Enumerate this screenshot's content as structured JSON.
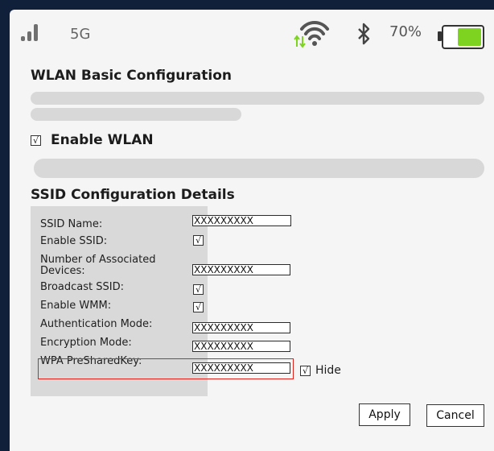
{
  "status_bar": {
    "network": "5G",
    "battery_percent": "70%",
    "battery_level": 0.7,
    "icons": [
      "signal-icon",
      "wifi-icon",
      "bluetooth-icon",
      "battery-icon"
    ]
  },
  "wlan_basic": {
    "title": "WLAN Basic Configuration",
    "enable_wlan_label": "Enable WLAN",
    "enable_wlan_checked": true
  },
  "ssid_config": {
    "title": "SSID Configuration Details",
    "ssid_name_label": "SSID Name:",
    "ssid_name_value": "XXXXXXXXX",
    "enable_ssid_label": "Enable SSID:",
    "associated_devices_label": "Number of Associated Devices:",
    "associated_devices_value": "XXXXXXXXX",
    "broadcast_ssid_label": "Broadcast SSID:",
    "enable_wmm_label": "Enable WMM:",
    "auth_mode_label": "Authentication Mode:",
    "auth_mode_value": "XXXXXXXXX",
    "encryption_mode_label": "Encryption Mode:",
    "encryption_mode_value": "XXXXXXXXX",
    "wpa_key_label": "WPA PreSharedKey:",
    "wpa_key_value": "XXXXXXXXX",
    "hide_label": "Hide",
    "check_mark": "√"
  },
  "actions": {
    "apply_label": "Apply",
    "cancel_label": "Cancel"
  },
  "colors": {
    "battery_fill": "#7ed321",
    "highlight": "#e0201a",
    "wifi_arrows": "#7ed321"
  }
}
